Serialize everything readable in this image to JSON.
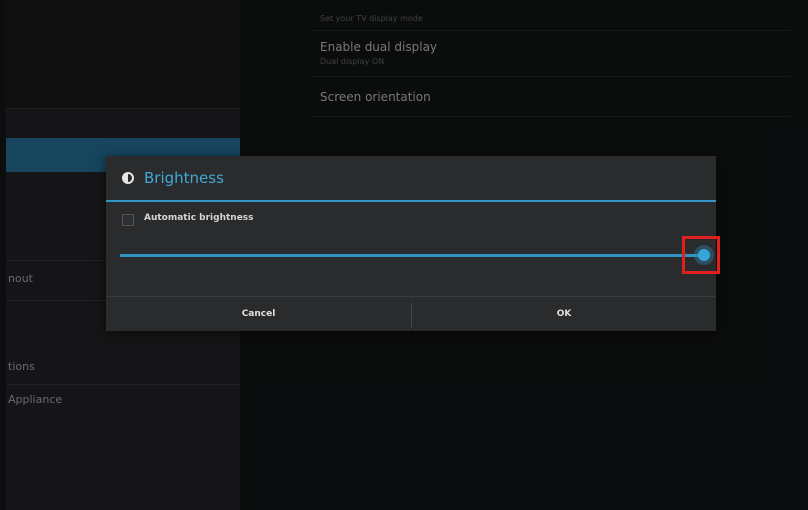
{
  "sidebar": {
    "items": [
      {
        "label": "nout"
      },
      {
        "label": "tions"
      },
      {
        "label": "Appliance"
      }
    ]
  },
  "settings": {
    "item1_subtitle": "Set your TV display mode",
    "item2_title": "Enable dual display",
    "item2_subtitle": "Dual display ON",
    "item3_title": "Screen orientation"
  },
  "dialog": {
    "title": "Brightness",
    "icon": "brightness-icon",
    "auto_label": "Automatic brightness",
    "auto_checked": false,
    "slider_value": 1.0,
    "cancel_label": "Cancel",
    "ok_label": "OK"
  },
  "colors": {
    "accent": "#3496c6",
    "highlight": "#e0201f"
  }
}
